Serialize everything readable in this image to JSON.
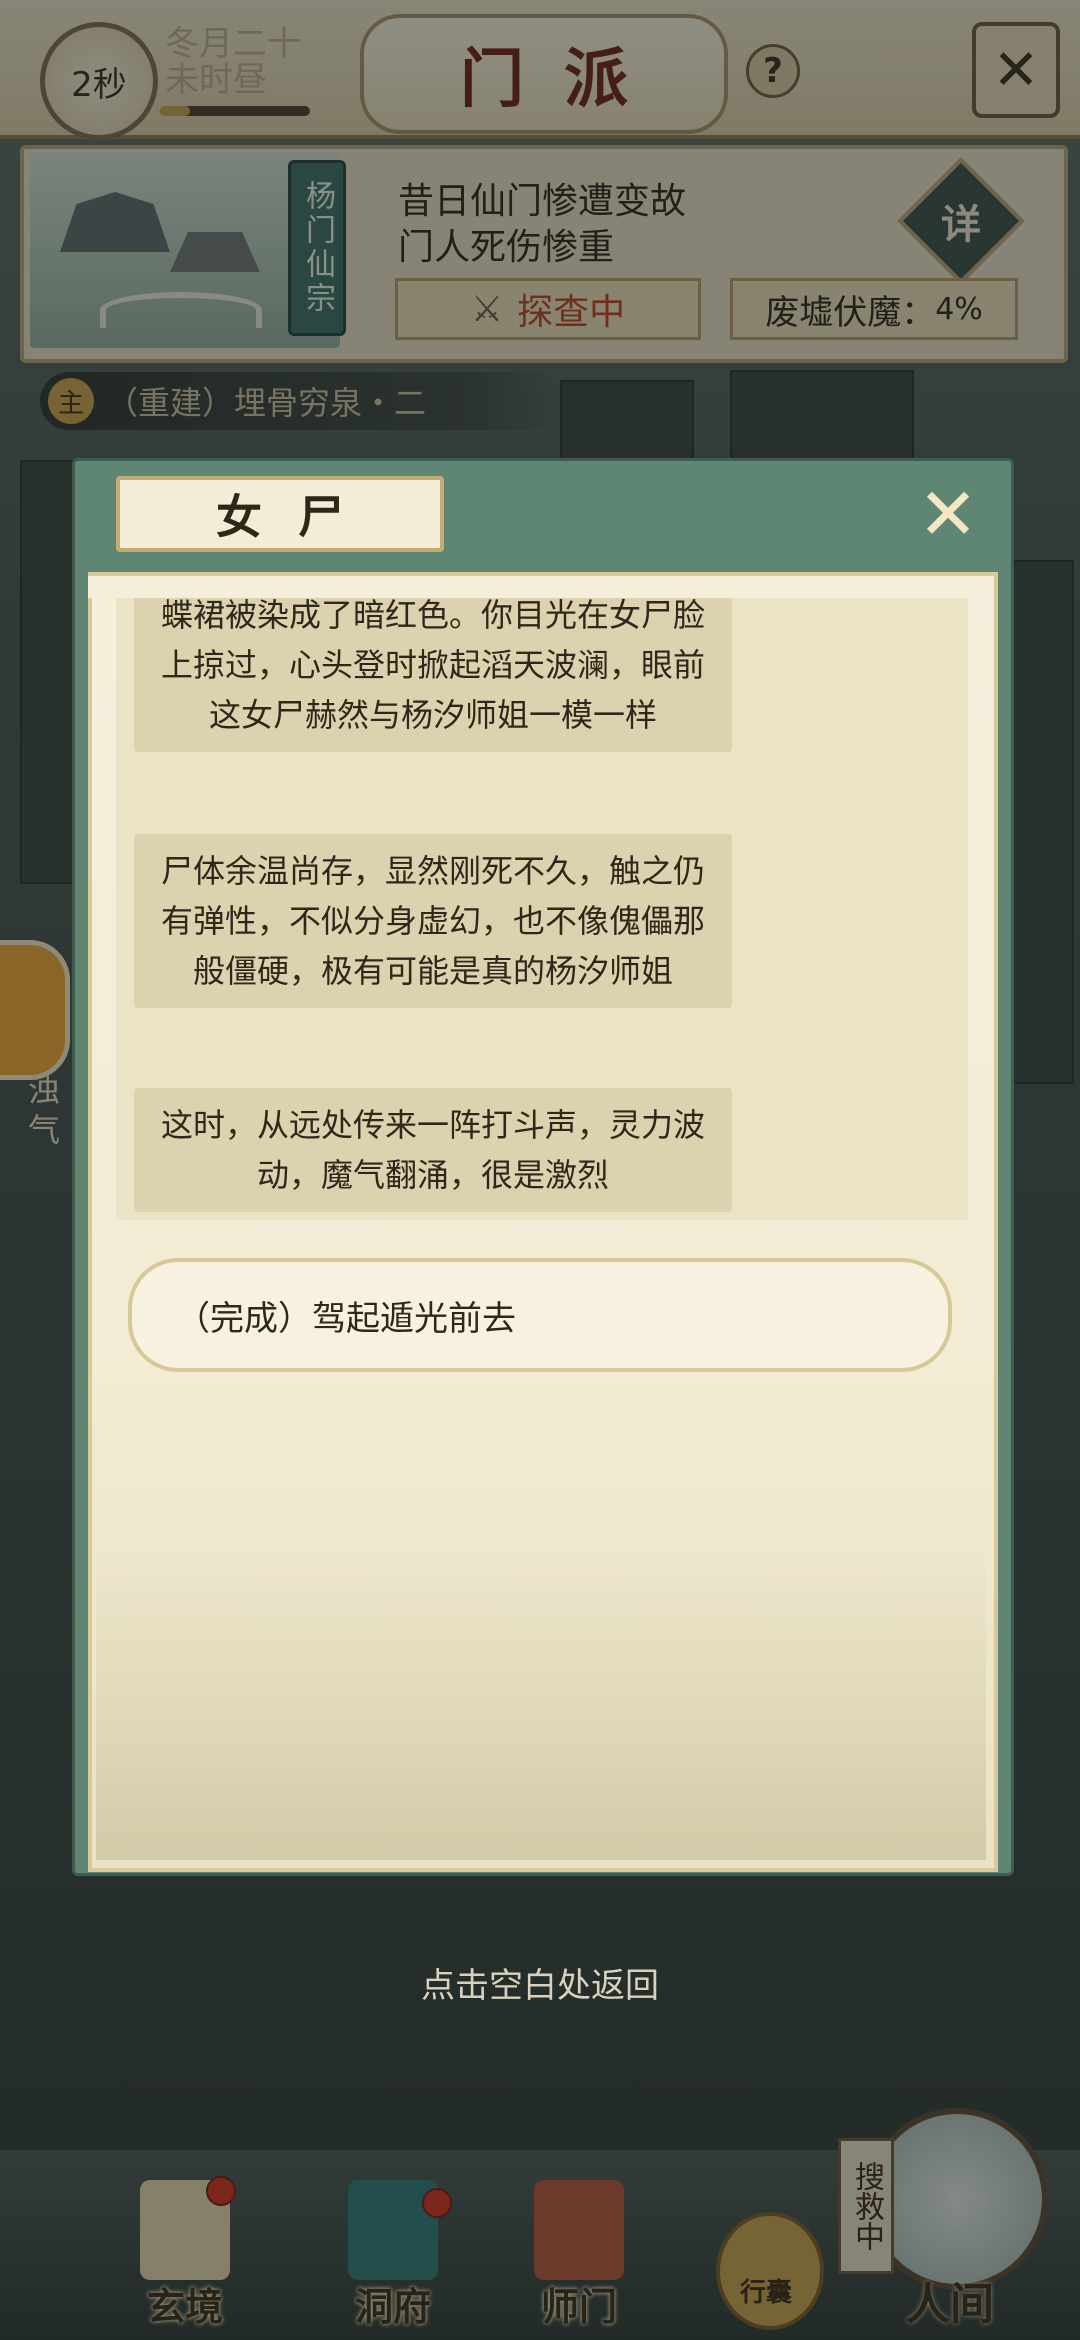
{
  "header": {
    "countdown": "2秒",
    "lunar_date": "冬月二十",
    "lunar_time": "未时昼",
    "title": "门派",
    "help": "?"
  },
  "sect": {
    "name": "杨门仙宗",
    "line1": "昔日仙门惨遭变故",
    "line2": "门人死伤惨重",
    "detail_label": "详",
    "explore_label": "探查中",
    "ruin_label": "废墟伏魔：",
    "ruin_progress": "4%"
  },
  "quest": {
    "tag": "主",
    "title": "（重建）埋骨穷泉・二"
  },
  "side": {
    "label": "浊气"
  },
  "dialog": {
    "title": "女尸",
    "paragraphs": [
      "蝶裙被染成了暗红色。你目光在女尸脸上掠过，心头登时掀起滔天波澜，眼前这女尸赫然与杨汐师姐一模一样",
      "尸体余温尚存，显然刚死不久，触之仍有弹性，不似分身虚幻，也不像傀儡那般僵硬，极有可能是真的杨汐师姐",
      "这时，从远处传来一阵打斗声，灵力波动，魔气翻涌，很是激烈"
    ],
    "choice": "（完成）驾起遁光前去"
  },
  "hint": "点击空白处返回",
  "nav": {
    "items": [
      {
        "label": "玄境"
      },
      {
        "label": "洞府"
      },
      {
        "label": "师门"
      },
      {
        "label": "行囊"
      },
      {
        "label": "人间"
      }
    ],
    "rescue_tag": "搜救中"
  }
}
